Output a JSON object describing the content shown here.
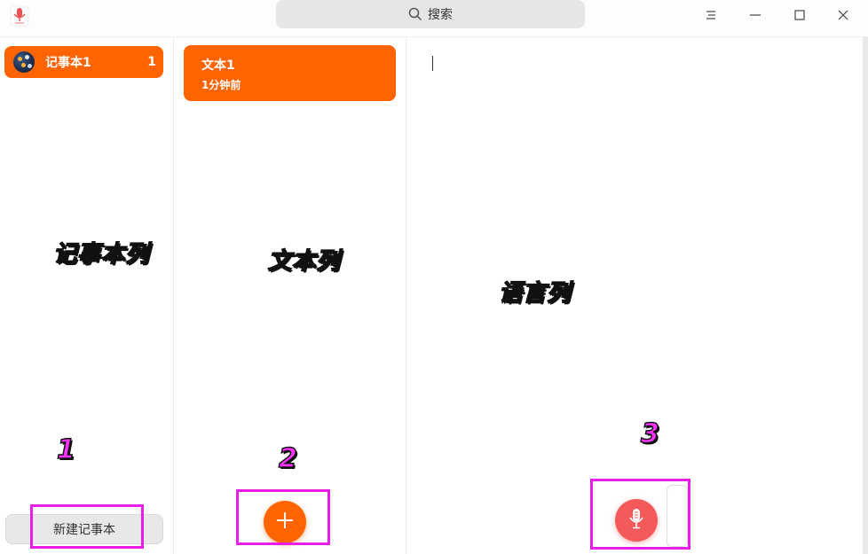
{
  "titlebar": {
    "search_label": "搜索"
  },
  "notebooks": {
    "items": [
      {
        "label": "记事本1",
        "count": "1"
      }
    ],
    "new_button_label": "新建记事本"
  },
  "notes": {
    "items": [
      {
        "title": "文本1",
        "time": "1分钟前"
      }
    ]
  },
  "annotations": {
    "notebook_column": "记事本列",
    "note_column": "文本列",
    "editor_column": "语言列",
    "marker_1": "1",
    "marker_2": "2",
    "marker_3": "3"
  },
  "colors": {
    "accent": "#ff6400",
    "mic": "#f55a5a",
    "annotation": "#e81ee8"
  },
  "icons": [
    "app-voice-note-icon",
    "search-icon",
    "menu-icon",
    "minimize-icon",
    "maximize-icon",
    "close-icon",
    "plus-icon",
    "microphone-icon"
  ]
}
